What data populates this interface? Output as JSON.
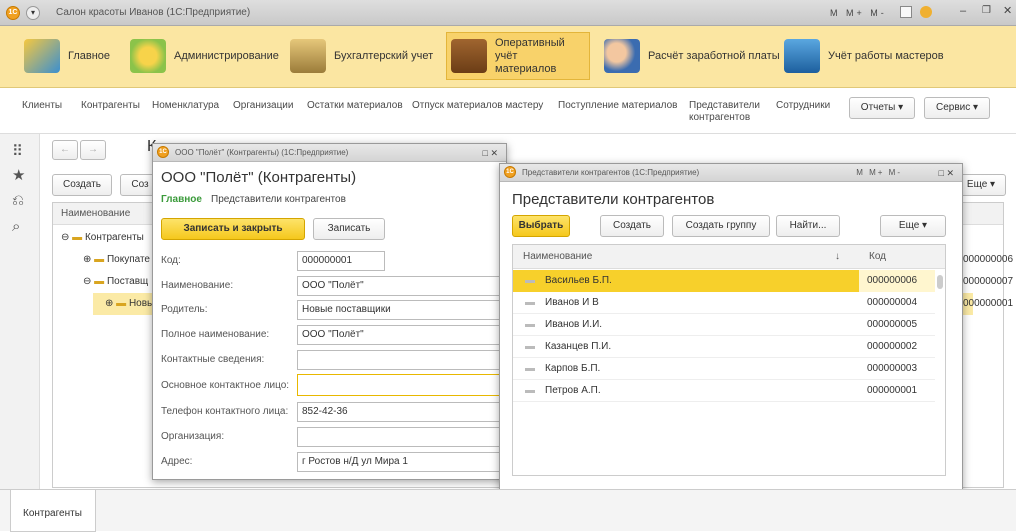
{
  "app": {
    "title": "Салон красоты Иванов  (1С:Предприятие)"
  },
  "sections": [
    {
      "label": "Главное"
    },
    {
      "label": "Администрирование"
    },
    {
      "label": "Бухгалтерский учет"
    },
    {
      "label": "Оперативный учёт материалов"
    },
    {
      "label": "Расчёт заработной платы"
    },
    {
      "label": "Учёт работы мастеров"
    }
  ],
  "nav": {
    "items": [
      "Клиенты",
      "Контрагенты",
      "Номенклатура",
      "Организации",
      "Остатки материалов",
      "Отпуск материалов мастеру",
      "Поступление материалов",
      "Представители контрагентов",
      "Сотрудники"
    ],
    "reports": "Отчеты",
    "service": "Сервис"
  },
  "bg": {
    "title": "К",
    "create": "Создать",
    "create2": "Соз",
    "more": "Еще",
    "col_name": "Наименование",
    "tree": [
      "Контрагенты",
      "Покупате",
      "Поставщ",
      "Новые"
    ],
    "codes": [
      "000000006",
      "000000007",
      "000000001"
    ]
  },
  "contragent": {
    "wintitle": "ООО \"Полёт\" (Контрагенты)  (1С:Предприятие)",
    "heading": "ООО \"Полёт\" (Контрагенты)",
    "tab_main": "Главное",
    "tab_reps": "Представители контрагентов",
    "save_close": "Записать и закрыть",
    "save": "Записать",
    "labels": [
      "Код:",
      "Наименование:",
      "Родитель:",
      "Полное наименование:",
      "Контактные сведения:",
      "Основное контактное лицо:",
      "Телефон контактного лица:",
      "Организация:",
      "Адрес:"
    ],
    "values": [
      "000000001",
      "ООО \"Полёт\"",
      "Новые поставщики",
      "ООО \"Полёт\"",
      "",
      "",
      "852-42-36",
      "",
      "г Ростов н/Д ул Мира 1"
    ]
  },
  "reps": {
    "wintitle": "Представители контрагентов  (1С:Предприятие)",
    "heading": "Представители контрагентов",
    "select": "Выбрать",
    "create": "Создать",
    "create_group": "Создать группу",
    "find": "Найти...",
    "more": "Еще",
    "col_name": "Наименование",
    "col_code": "Код",
    "rows": [
      {
        "name": "Васильев Б.П.",
        "code": "000000006"
      },
      {
        "name": "Иванов И В",
        "code": "000000004"
      },
      {
        "name": "Иванов И.И.",
        "code": "000000005"
      },
      {
        "name": "Казанцев П.И.",
        "code": "000000002"
      },
      {
        "name": "Карпов Б.П.",
        "code": "000000003"
      },
      {
        "name": "Петров А.П.",
        "code": "000000001"
      }
    ]
  },
  "bottom": {
    "tab": "Контрагенты"
  }
}
